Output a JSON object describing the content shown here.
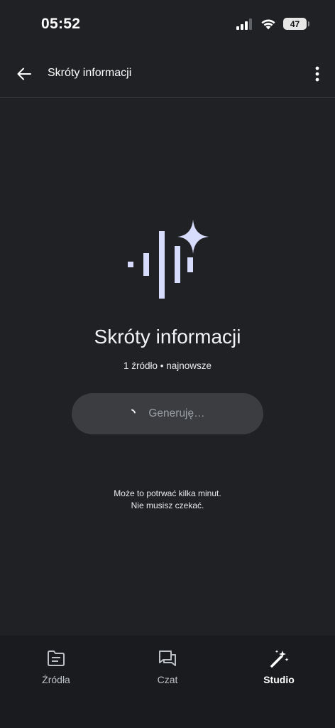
{
  "status_bar": {
    "time": "05:52",
    "battery": "47",
    "icons": [
      "signal-icon",
      "wifi-icon",
      "battery-icon"
    ]
  },
  "app_bar": {
    "title": "Skróty informacji",
    "icons": [
      "back-arrow-icon",
      "more-vert-icon"
    ]
  },
  "main": {
    "icon": "audio-sparkle-icon",
    "title": "Skróty informacji",
    "subtitle": "1 źródło • najnowsze",
    "generate_button": {
      "label": "Generuję…",
      "icon": "spinner-icon"
    },
    "note_line1": "Może to potrwać kilka minut.",
    "note_line2": "Nie musisz czekać."
  },
  "bottom_nav": {
    "items": [
      {
        "label": "Źródła",
        "icon": "document-icon",
        "active": false
      },
      {
        "label": "Czat",
        "icon": "chat-icon",
        "active": false
      },
      {
        "label": "Studio",
        "icon": "magic-wand-icon",
        "active": true
      }
    ]
  },
  "colors": {
    "background": "#202124",
    "nav_background": "#1a1b1e",
    "button_background": "#3c3d40",
    "accent_icon": "#d7dcfc"
  }
}
